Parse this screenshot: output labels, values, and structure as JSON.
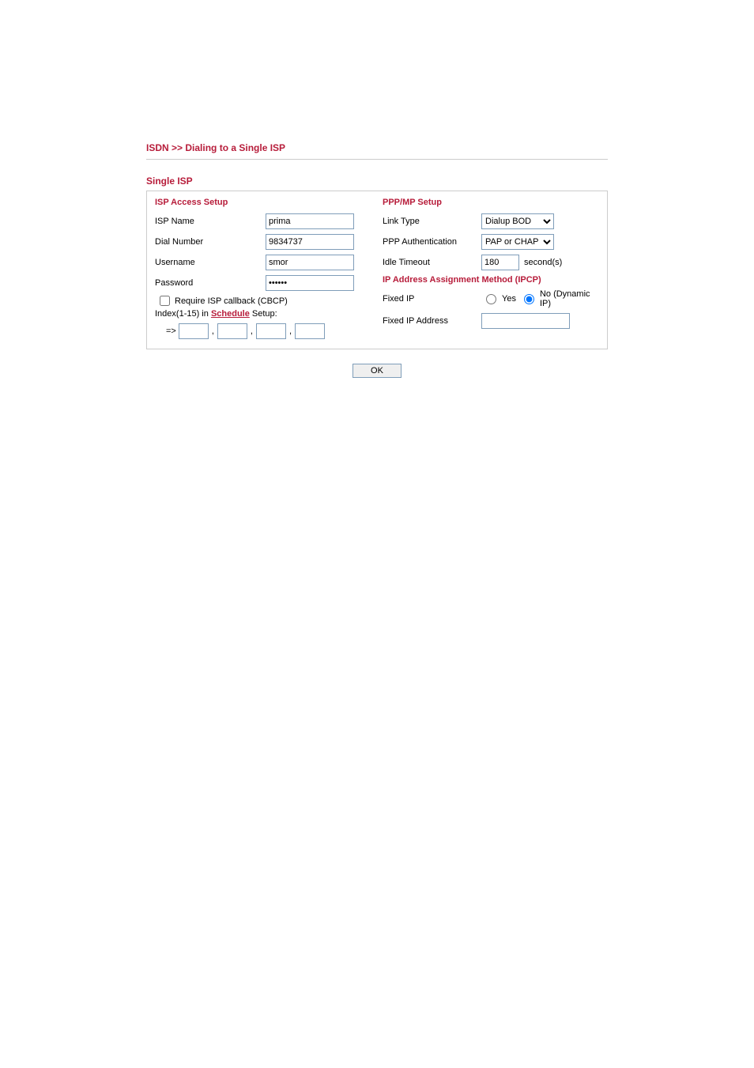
{
  "breadcrumb": {
    "part1": "ISDN",
    "separator": ">>",
    "part2": "Dialing to a Single ISP"
  },
  "section_title": "Single ISP",
  "left": {
    "heading": "ISP Access Setup",
    "isp_name": {
      "label": "ISP Name",
      "value": "prima"
    },
    "dial_number": {
      "label": "Dial Number",
      "value": "9834737"
    },
    "username": {
      "label": "Username",
      "value": "smor"
    },
    "password": {
      "label": "Password",
      "value": "••••••"
    },
    "require_callback": {
      "label": "Require ISP callback (CBCP)",
      "checked": false
    },
    "schedule": {
      "prefix": "Index(1-15) in ",
      "link": "Schedule",
      "suffix": " Setup:",
      "arrow": "=>",
      "values": [
        "",
        "",
        "",
        ""
      ]
    }
  },
  "right": {
    "heading": "PPP/MP Setup",
    "link_type": {
      "label": "Link Type",
      "selected": "Dialup BOD",
      "options": [
        "Dialup BOD"
      ]
    },
    "ppp_auth": {
      "label": "PPP Authentication",
      "selected": "PAP or CHAP",
      "options": [
        "PAP or CHAP"
      ]
    },
    "idle_timeout": {
      "label": "Idle Timeout",
      "value": "180",
      "unit": "second(s)"
    },
    "ipcp_heading": "IP Address Assignment Method (IPCP)",
    "fixed_ip": {
      "label": "Fixed IP",
      "yes": "Yes",
      "no": "No (Dynamic IP)",
      "selected": "no"
    },
    "fixed_ip_address": {
      "label": "Fixed IP Address",
      "value": ""
    }
  },
  "buttons": {
    "ok": "OK"
  }
}
